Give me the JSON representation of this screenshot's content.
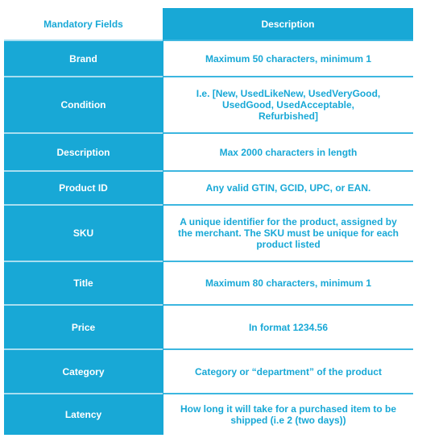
{
  "table": {
    "header": {
      "fields_label": "Mandatory Fields",
      "description_label": "Description"
    },
    "rows": [
      {
        "field": "Brand",
        "description": "Maximum 50 characters, minimum 1"
      },
      {
        "field": "Condition",
        "description": "I.e. [New, UsedLikeNew, UsedVeryGood, UsedGood, UsedAcceptable, Refurbished]"
      },
      {
        "field": "Description",
        "description": "Max 2000 characters in length"
      },
      {
        "field": "Product ID",
        "description": "Any valid GTIN, GCID, UPC, or EAN."
      },
      {
        "field": "SKU",
        "description": "A unique identifier for the product, assigned by the merchant. The SKU must be unique for each product listed"
      },
      {
        "field": "Title",
        "description": "Maximum 80 characters, minimum 1"
      },
      {
        "field": "Price",
        "description": "In format 1234.56"
      },
      {
        "field": "Category",
        "description": "Category or “department” of the product"
      },
      {
        "field": "Latency",
        "description": "How long it will take for a purchased item to be shipped (i.e 2 (two days))"
      }
    ]
  },
  "colors": {
    "accent": "#18a8d6",
    "background": "#ffffff"
  }
}
